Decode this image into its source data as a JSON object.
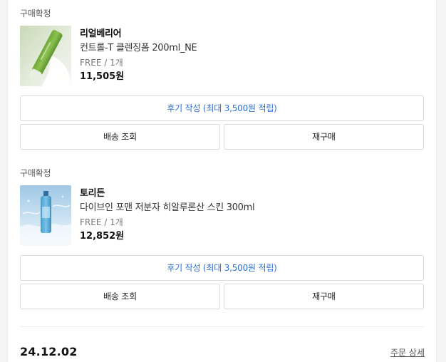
{
  "orders": [
    {
      "status": "구매확정",
      "brand": "리얼베리어",
      "product_name": "컨트롤-T 클렌징폼 200ml_NE",
      "option": "FREE / 1개",
      "price": "11,505원",
      "thumbnail_icon": "green-cleansing-foam-tube-image",
      "review_button": "후기 작성 (최대 3,500원 적립)",
      "shipping_button": "배송 조회",
      "reorder_button": "재구매"
    },
    {
      "status": "구매확정",
      "brand": "토리든",
      "product_name": "다이브인 포맨 저분자 히알루론산 스킨 300ml",
      "option": "FREE / 1개",
      "price": "12,852원",
      "thumbnail_icon": "blue-toner-bottle-image",
      "review_button": "후기 작성 (최대 3,500원 적립)",
      "shipping_button": "배송 조회",
      "reorder_button": "재구매"
    }
  ],
  "next_group": {
    "date": "24.12.02",
    "detail_link": "주문 상세"
  },
  "colors": {
    "review_text": "#2e6fd6",
    "border": "#d9d9d9"
  }
}
